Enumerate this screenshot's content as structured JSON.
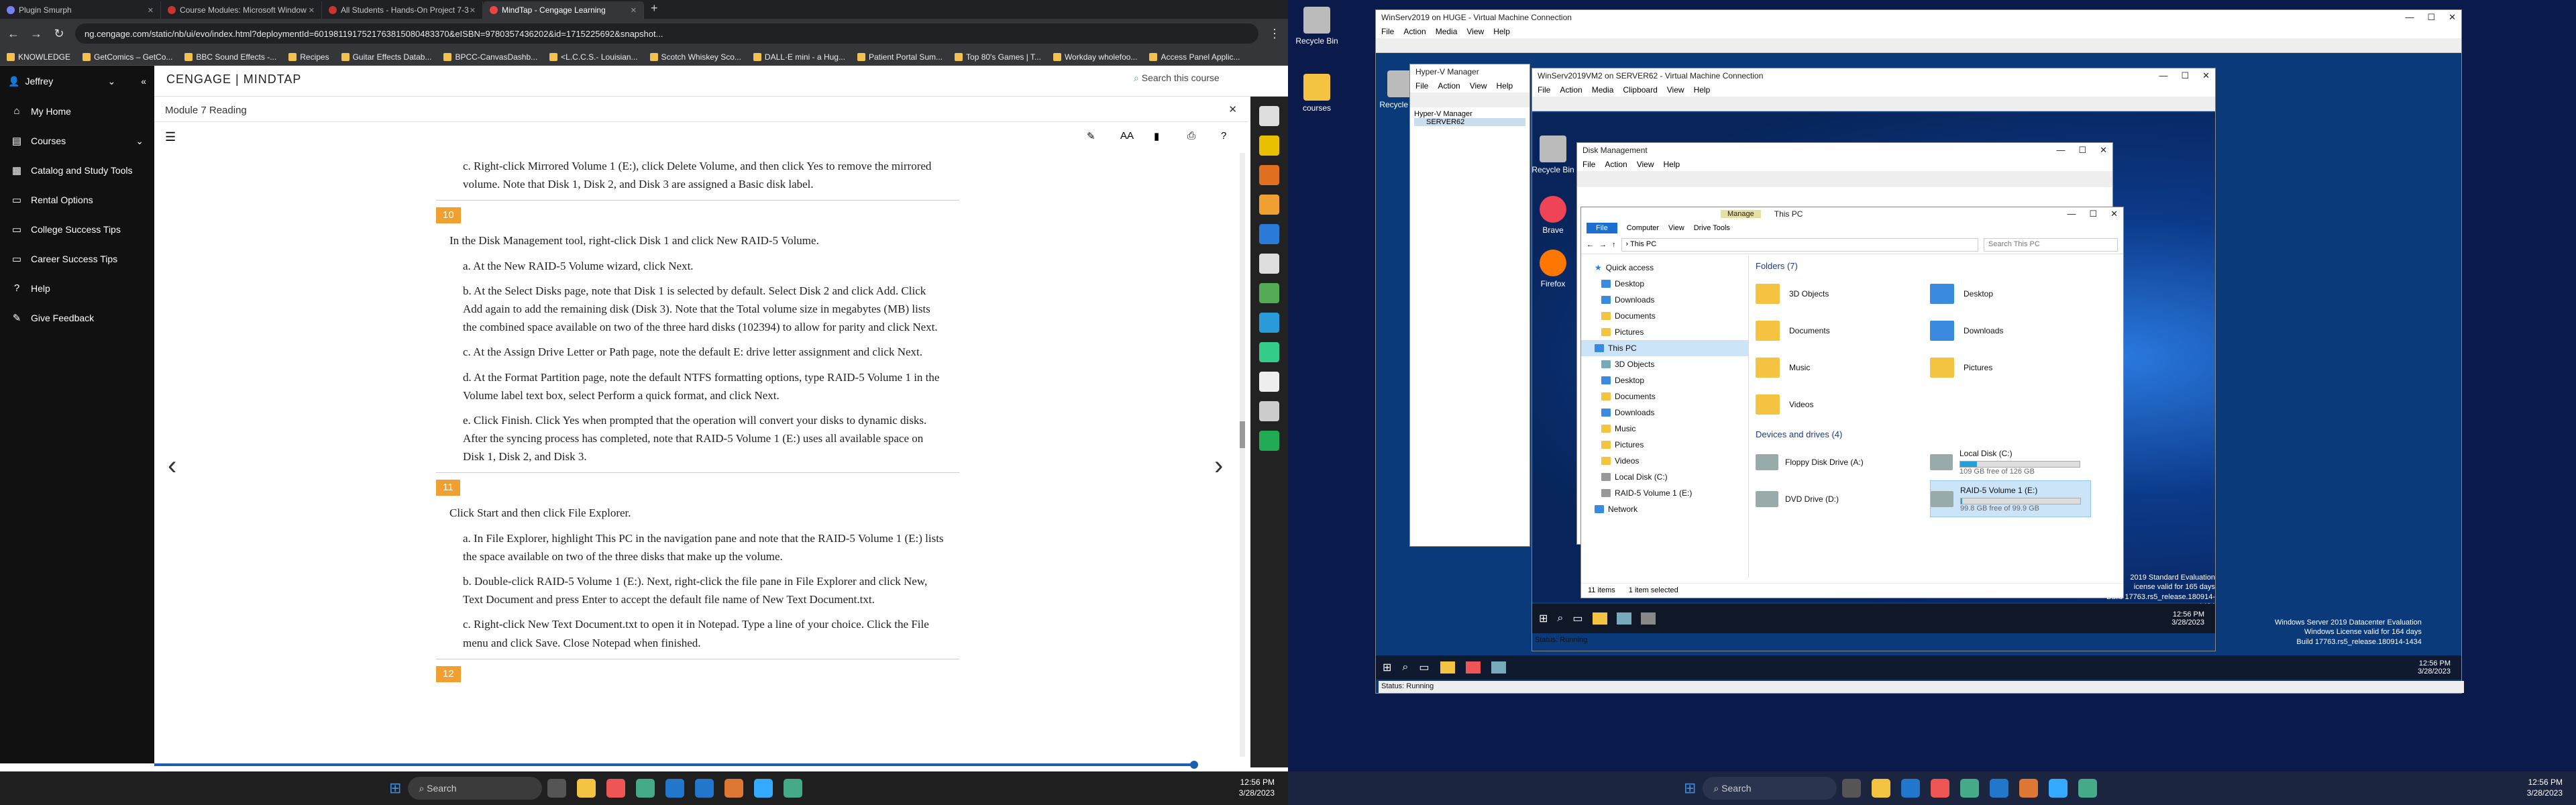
{
  "browser": {
    "tabs": [
      "Plugin Smurph",
      "Course Modules: Microsoft Window",
      "All Students - Hands-On Project 7-3",
      "MindTap - Cengage Learning"
    ],
    "url": "ng.cengage.com/static/nb/ui/evo/index.html?deploymentId=6019811917521763815080483370&eISBN=9780357436202&id=1715225692&snapshot...",
    "bookmarks": [
      "KNOWLEDGE",
      "GetComics – GetCo...",
      "BBC Sound Effects -...",
      "Recipes",
      "Guitar Effects Datab...",
      "BPCC-CanvasDashb...",
      "<L.C.C.S.- Louisian...",
      "Scotch Whiskey Sco...",
      "DALL·E mini - a Hug...",
      "Patient Portal Sum...",
      "Top 80's Games | T...",
      "Workday wholefoo...",
      "Access Panel Applic..."
    ]
  },
  "mindtap": {
    "logo": "CENGAGE | MINDTAP",
    "search_placeholder": "Search this course",
    "user": "Jeffrey",
    "sidebar": [
      "My Home",
      "Courses",
      "Catalog and Study Tools",
      "Rental Options",
      "College Success Tips",
      "Career Success Tips",
      "Help",
      "Give Feedback"
    ],
    "module_title": "Module 7 Reading",
    "content": {
      "c_prev": "c. Right-click Mirrored Volume 1 (E:), click Delete Volume, and then click Yes to remove the mirrored volume. Note that Disk 1, Disk 2, and Disk 3 are assigned a Basic disk label.",
      "step10": "10",
      "step10_text": "In the Disk Management tool, right-click Disk 1 and click New RAID-5 Volume.",
      "s10a": "a. At the New RAID-5 Volume wizard, click Next.",
      "s10b": "b. At the Select Disks page, note that Disk 1 is selected by default. Select Disk 2 and click Add. Click Add again to add the remaining disk (Disk 3). Note that the Total volume size in megabytes (MB) lists the combined space available on two of the three hard disks (102394) to allow for parity and click Next.",
      "s10c": "c. At the Assign Drive Letter or Path page, note the default E: drive letter assignment and click Next.",
      "s10d": "d. At the Format Partition page, note the default NTFS formatting options, type RAID-5 Volume 1 in the Volume label text box, select Perform a quick format, and click Next.",
      "s10e": "e. Click Finish. Click Yes when prompted that the operation will convert your disks to dynamic disks. After the syncing process has completed, note that RAID-5 Volume 1 (E:) uses all available space on Disk 1, Disk 2, and Disk 3.",
      "step11": "11",
      "step11_text": "Click Start and then click File Explorer.",
      "s11a": "a. In File Explorer, highlight This PC in the navigation pane and note that the RAID-5 Volume 1 (E:) lists the space available on two of the three disks that make up the volume.",
      "s11b": "b. Double-click RAID-5 Volume 1 (E:). Next, right-click the file pane in File Explorer and click New, Text Document and press Enter to accept the default file name of New Text Document.txt.",
      "s11c": "c. Right-click New Text Document.txt to open it in Notepad. Type a line of your choice. Click the File menu and click Save. Close Notepad when finished.",
      "step12": "12"
    }
  },
  "taskbar_left": {
    "search": "Search",
    "time": "12:56 PM",
    "date": "3/28/2023"
  },
  "right": {
    "recycle_bin": "Recycle Bin",
    "courses": "courses",
    "outer_vm_title": "WinServ2019 on HUGE - Virtual Machine Connection",
    "outer_menu": [
      "File",
      "Action",
      "Media",
      "View",
      "Help"
    ],
    "hyperv_title": "Hyper-V Manager",
    "hyperv_menu": [
      "File",
      "Action",
      "View",
      "Help"
    ],
    "hyperv_tree": [
      "Hyper-V Manager",
      "SERVER62"
    ],
    "inner_vm_title": "WinServ2019VM2 on SERVER62 - Virtual Machine Connection",
    "inner_menu": [
      "File",
      "Action",
      "Media",
      "Clipboard",
      "View",
      "Help"
    ],
    "inner_desktop": [
      "Recycle Bin",
      "Brave",
      "Firefox"
    ],
    "diskmgmt_title": "Disk Management",
    "diskmgmt_menu": [
      "File",
      "Action",
      "View",
      "Help"
    ],
    "explorer": {
      "title": "This PC",
      "ribbon": [
        "File",
        "Computer",
        "View"
      ],
      "manage": "Manage",
      "drive_tools": "Drive Tools",
      "path": "This PC",
      "search": "Search This PC",
      "nav": [
        "Quick access",
        "Desktop",
        "Downloads",
        "Documents",
        "Pictures",
        "This PC",
        "3D Objects",
        "Desktop",
        "Documents",
        "Downloads",
        "Music",
        "Pictures",
        "Videos",
        "Local Disk (C:)",
        "RAID-5 Volume 1 (E:)",
        "Network"
      ],
      "folders_header": "Folders (7)",
      "folders": [
        "3D Objects",
        "Desktop",
        "Documents",
        "Downloads",
        "Music",
        "Pictures",
        "Videos"
      ],
      "drives_header": "Devices and drives (4)",
      "drives": [
        {
          "name": "Floppy Disk Drive (A:)",
          "free": "",
          "fill": 0
        },
        {
          "name": "Local Disk (C:)",
          "free": "109 GB free of 126 GB",
          "fill": 0.14
        },
        {
          "name": "DVD Drive (D:)",
          "free": "",
          "fill": 0
        },
        {
          "name": "RAID-5 Volume 1 (E:)",
          "free": "99.8 GB free of 99.9 GB",
          "fill": 0.01
        }
      ],
      "status_items": "11 items",
      "status_selected": "1 item selected"
    },
    "inner_status": "Status: Running",
    "outer_status": "Status: Running",
    "watermark_inner": [
      "2019 Standard Evaluation",
      "icense valid for 165 days",
      "Build 17763.rs5_release.180914-1434"
    ],
    "watermark_outer": [
      "Windows Server 2019 Datacenter Evaluation",
      "Windows License valid for 164 days",
      "Build 17763.rs5_release.180914-1434"
    ],
    "inner_time": "12:56 PM",
    "inner_date": "3/28/2023",
    "outer_time": "12:56 PM",
    "outer_date": "3/28/2023",
    "taskbar_search": "Search",
    "host_time": "12:56 PM",
    "host_date": "3/28/2023"
  }
}
